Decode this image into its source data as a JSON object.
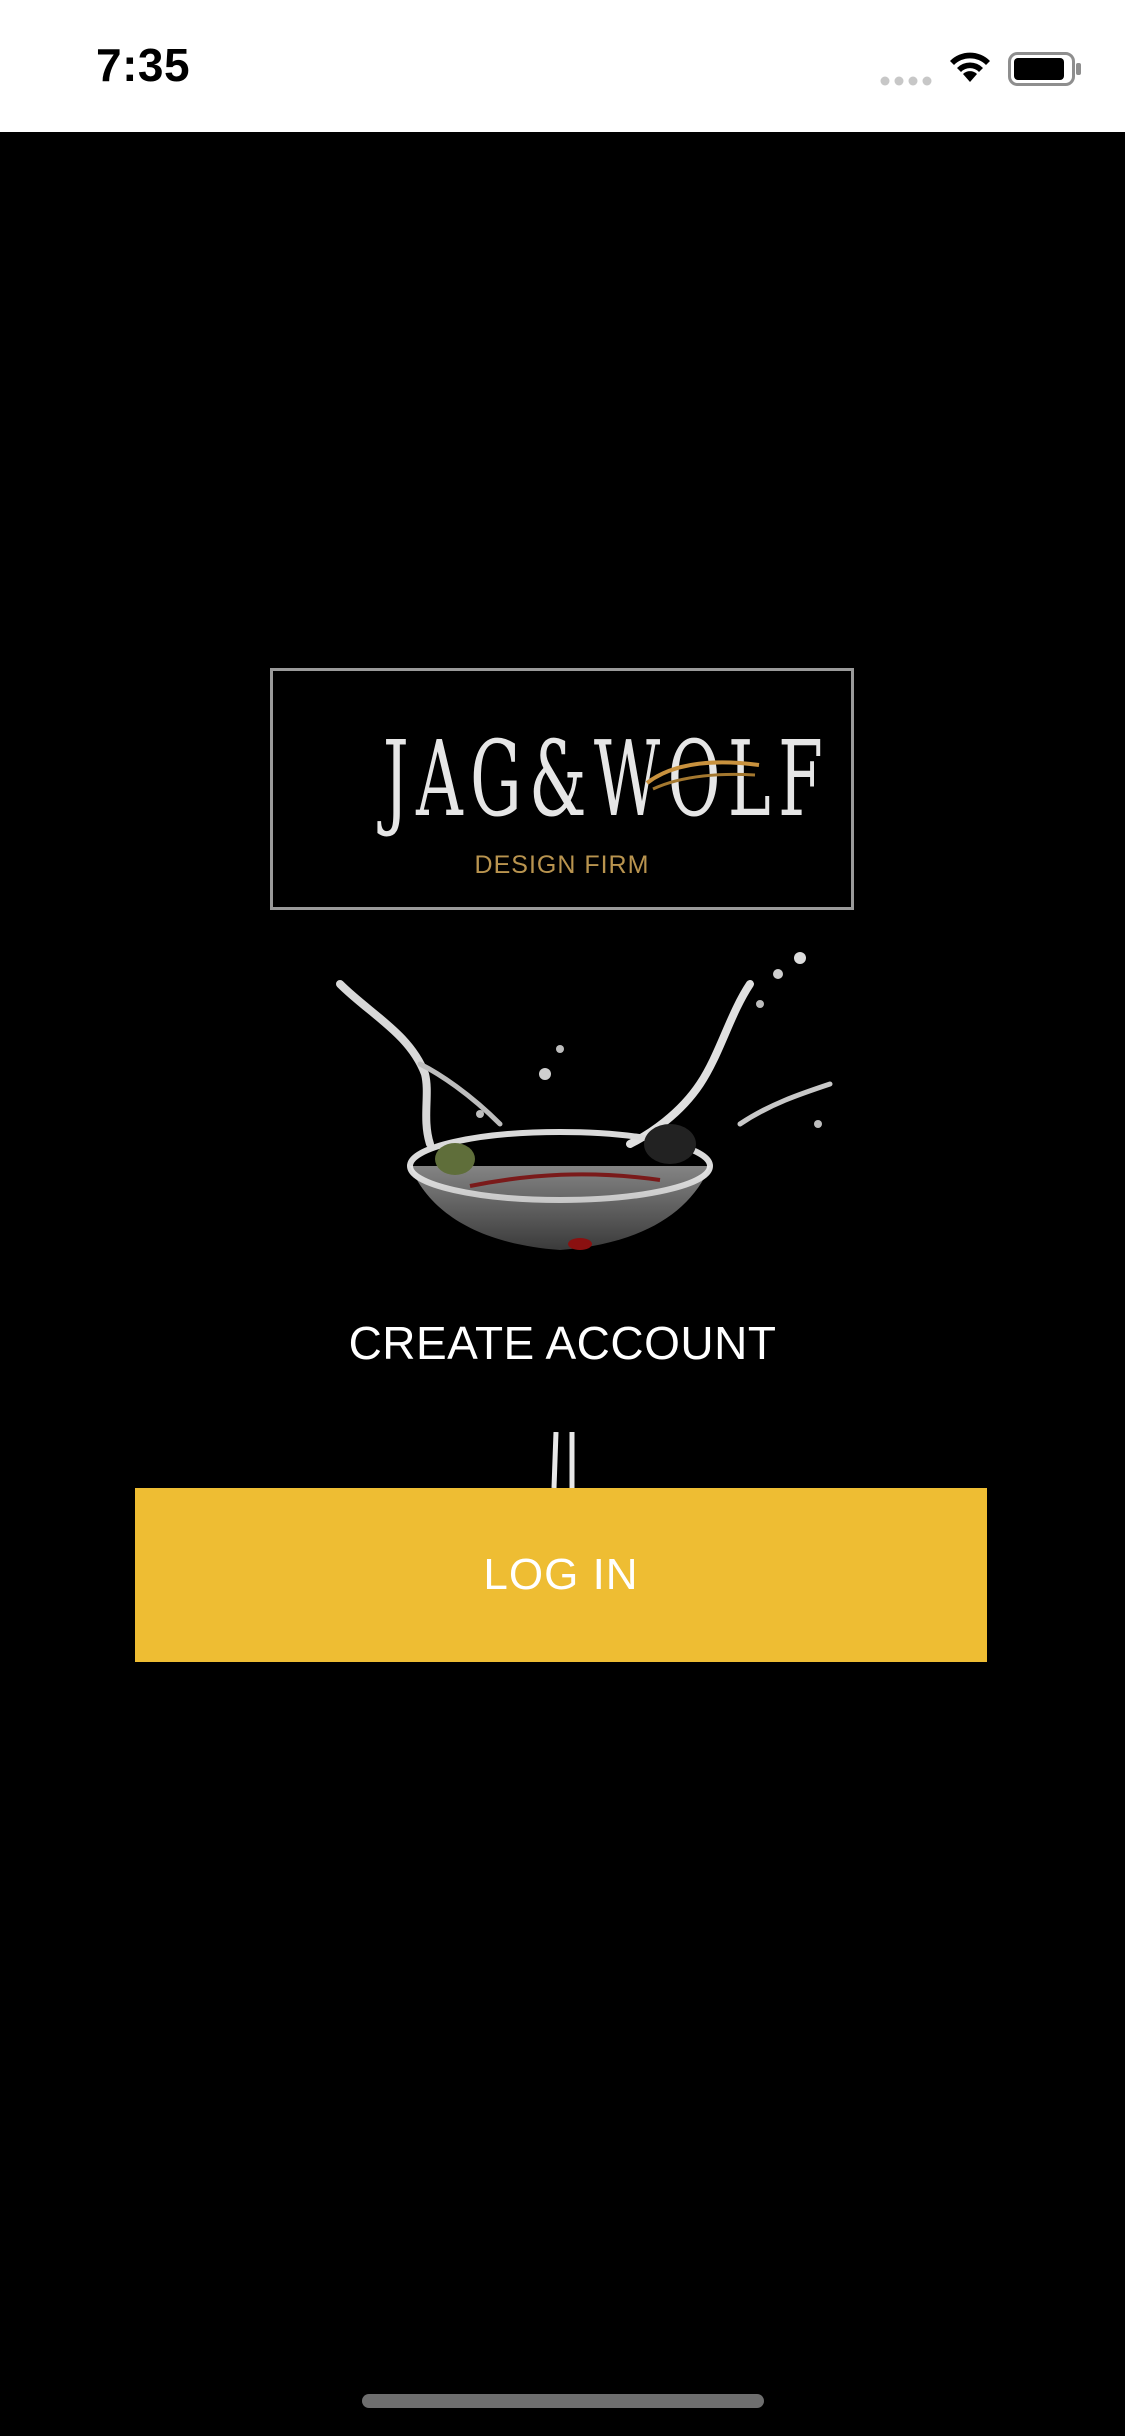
{
  "status_bar": {
    "time": "7:35",
    "icons": [
      "cellular-signal-icon",
      "wifi-icon",
      "battery-icon"
    ]
  },
  "logo": {
    "wordmark": "JAG&WOLF",
    "subtitle": "DESIGN FIRM"
  },
  "actions": {
    "create_account_label": "CREATE ACCOUNT",
    "login_label": "LOG IN"
  },
  "colors": {
    "background": "#000000",
    "accent": "#eebd33",
    "logo_subtitle": "#b9944f",
    "status_bar_bg": "#ffffff"
  }
}
